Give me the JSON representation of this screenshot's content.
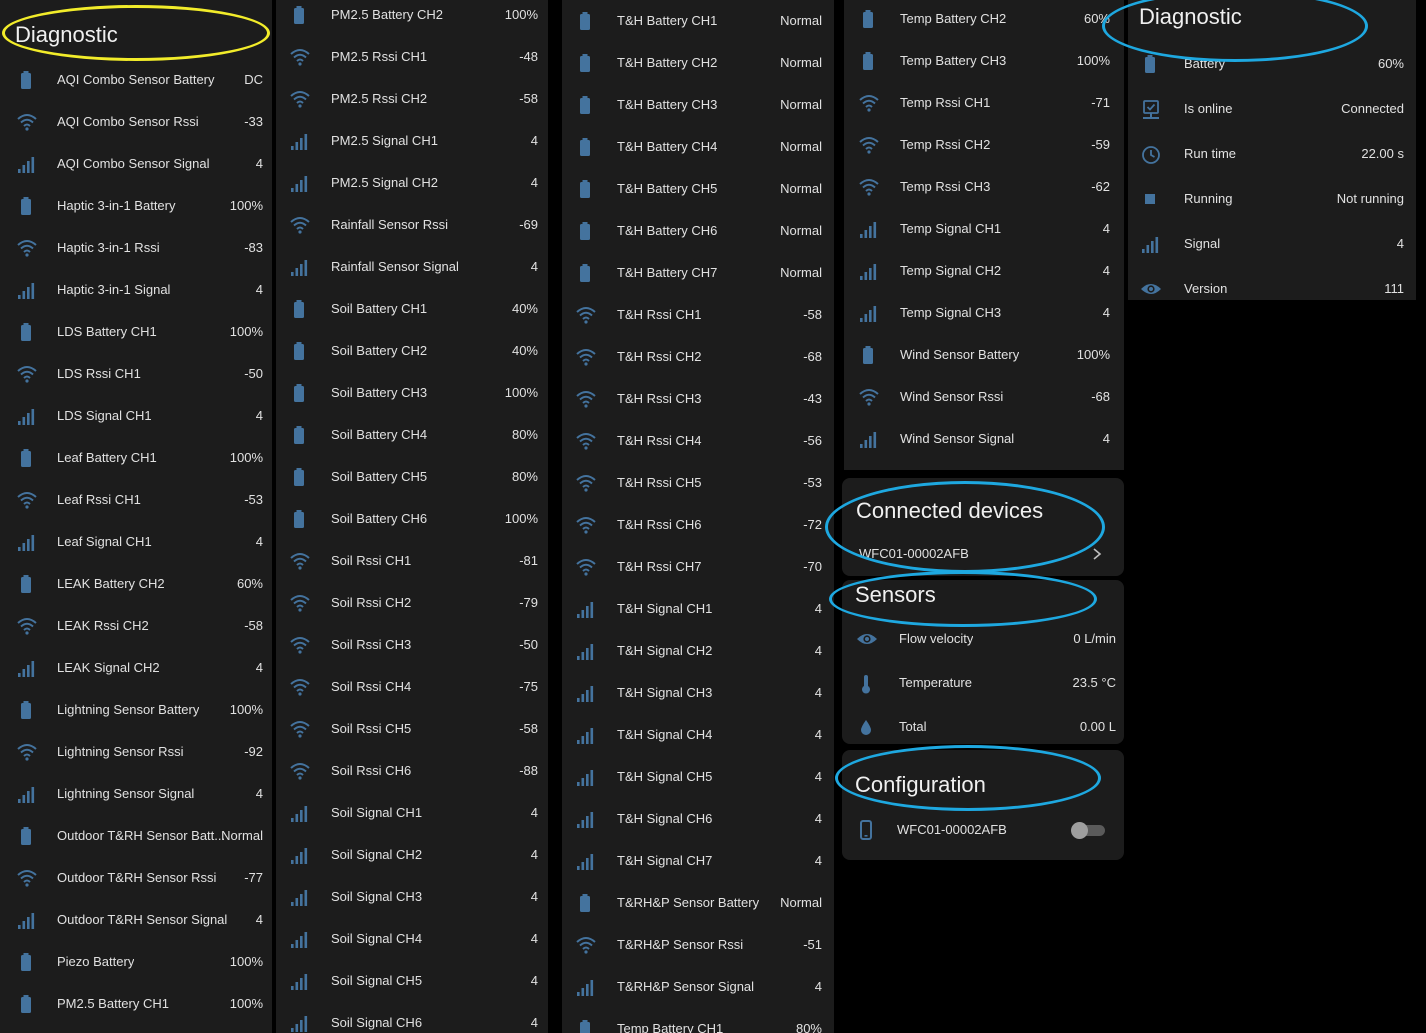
{
  "colors": {
    "accent": "#44739e",
    "background": "#1c1c1c",
    "yellow_annotation": "#f2ec2a",
    "blue_annotation": "#1ea8e0",
    "toggle_off": "#9e9e9e"
  },
  "diagnostic_title": "Diagnostic",
  "col1": [
    {
      "icon": "battery-icon",
      "name": "AQI Combo Sensor Battery",
      "value": "DC"
    },
    {
      "icon": "wifi-icon",
      "name": "AQI Combo Sensor Rssi",
      "value": "-33"
    },
    {
      "icon": "signal-icon",
      "name": "AQI Combo Sensor Signal",
      "value": "4"
    },
    {
      "icon": "battery-icon",
      "name": "Haptic 3-in-1 Battery",
      "value": "100%"
    },
    {
      "icon": "wifi-icon",
      "name": "Haptic 3-in-1 Rssi",
      "value": "-83"
    },
    {
      "icon": "signal-icon",
      "name": "Haptic 3-in-1 Signal",
      "value": "4"
    },
    {
      "icon": "battery-icon",
      "name": "LDS Battery CH1",
      "value": "100%"
    },
    {
      "icon": "wifi-icon",
      "name": "LDS Rssi CH1",
      "value": "-50"
    },
    {
      "icon": "signal-icon",
      "name": "LDS Signal CH1",
      "value": "4"
    },
    {
      "icon": "battery-icon",
      "name": "Leaf Battery CH1",
      "value": "100%"
    },
    {
      "icon": "wifi-icon",
      "name": "Leaf Rssi CH1",
      "value": "-53"
    },
    {
      "icon": "signal-icon",
      "name": "Leaf Signal CH1",
      "value": "4"
    },
    {
      "icon": "battery-icon",
      "name": "LEAK Battery CH2",
      "value": "60%"
    },
    {
      "icon": "wifi-icon",
      "name": "LEAK Rssi CH2",
      "value": "-58"
    },
    {
      "icon": "signal-icon",
      "name": "LEAK Signal CH2",
      "value": "4"
    },
    {
      "icon": "battery-icon",
      "name": "Lightning Sensor Battery",
      "value": "100%"
    },
    {
      "icon": "wifi-icon",
      "name": "Lightning Sensor Rssi",
      "value": "-92"
    },
    {
      "icon": "signal-icon",
      "name": "Lightning Sensor Signal",
      "value": "4"
    },
    {
      "icon": "battery-icon",
      "name": "Outdoor T&RH Sensor Batt...",
      "value": "Normal"
    },
    {
      "icon": "wifi-icon",
      "name": "Outdoor T&RH Sensor Rssi",
      "value": "-77"
    },
    {
      "icon": "signal-icon",
      "name": "Outdoor T&RH Sensor Signal",
      "value": "4"
    },
    {
      "icon": "battery-icon",
      "name": "Piezo Battery",
      "value": "100%"
    },
    {
      "icon": "battery-icon",
      "name": "PM2.5 Battery CH1",
      "value": "100%"
    }
  ],
  "col2": [
    {
      "icon": "battery-icon",
      "name": "PM2.5 Battery CH2",
      "value": "100%"
    },
    {
      "icon": "wifi-icon",
      "name": "PM2.5 Rssi CH1",
      "value": "-48"
    },
    {
      "icon": "wifi-icon",
      "name": "PM2.5 Rssi CH2",
      "value": "-58"
    },
    {
      "icon": "signal-icon",
      "name": "PM2.5 Signal CH1",
      "value": "4"
    },
    {
      "icon": "signal-icon",
      "name": "PM2.5 Signal CH2",
      "value": "4"
    },
    {
      "icon": "wifi-icon",
      "name": "Rainfall Sensor Rssi",
      "value": "-69"
    },
    {
      "icon": "signal-icon",
      "name": "Rainfall Sensor Signal",
      "value": "4"
    },
    {
      "icon": "battery-icon",
      "name": "Soil Battery CH1",
      "value": "40%"
    },
    {
      "icon": "battery-icon",
      "name": "Soil Battery CH2",
      "value": "40%"
    },
    {
      "icon": "battery-icon",
      "name": "Soil Battery CH3",
      "value": "100%"
    },
    {
      "icon": "battery-icon",
      "name": "Soil Battery CH4",
      "value": "80%"
    },
    {
      "icon": "battery-icon",
      "name": "Soil Battery CH5",
      "value": "80%"
    },
    {
      "icon": "battery-icon",
      "name": "Soil Battery CH6",
      "value": "100%"
    },
    {
      "icon": "wifi-icon",
      "name": "Soil Rssi CH1",
      "value": "-81"
    },
    {
      "icon": "wifi-icon",
      "name": "Soil Rssi CH2",
      "value": "-79"
    },
    {
      "icon": "wifi-icon",
      "name": "Soil Rssi CH3",
      "value": "-50"
    },
    {
      "icon": "wifi-icon",
      "name": "Soil Rssi CH4",
      "value": "-75"
    },
    {
      "icon": "wifi-icon",
      "name": "Soil Rssi CH5",
      "value": "-58"
    },
    {
      "icon": "wifi-icon",
      "name": "Soil Rssi CH6",
      "value": "-88"
    },
    {
      "icon": "signal-icon",
      "name": "Soil Signal CH1",
      "value": "4"
    },
    {
      "icon": "signal-icon",
      "name": "Soil Signal CH2",
      "value": "4"
    },
    {
      "icon": "signal-icon",
      "name": "Soil Signal CH3",
      "value": "4"
    },
    {
      "icon": "signal-icon",
      "name": "Soil Signal CH4",
      "value": "4"
    },
    {
      "icon": "signal-icon",
      "name": "Soil Signal CH5",
      "value": "4"
    },
    {
      "icon": "signal-icon",
      "name": "Soil Signal CH6",
      "value": "4"
    }
  ],
  "col3": [
    {
      "icon": "battery-icon",
      "name": "T&H Battery CH1",
      "value": "Normal"
    },
    {
      "icon": "battery-icon",
      "name": "T&H Battery CH2",
      "value": "Normal"
    },
    {
      "icon": "battery-icon",
      "name": "T&H Battery CH3",
      "value": "Normal"
    },
    {
      "icon": "battery-icon",
      "name": "T&H Battery CH4",
      "value": "Normal"
    },
    {
      "icon": "battery-icon",
      "name": "T&H Battery CH5",
      "value": "Normal"
    },
    {
      "icon": "battery-icon",
      "name": "T&H Battery CH6",
      "value": "Normal"
    },
    {
      "icon": "battery-icon",
      "name": "T&H Battery CH7",
      "value": "Normal"
    },
    {
      "icon": "wifi-icon",
      "name": "T&H Rssi CH1",
      "value": "-58"
    },
    {
      "icon": "wifi-icon",
      "name": "T&H Rssi CH2",
      "value": "-68"
    },
    {
      "icon": "wifi-icon",
      "name": "T&H Rssi CH3",
      "value": "-43"
    },
    {
      "icon": "wifi-icon",
      "name": "T&H Rssi CH4",
      "value": "-56"
    },
    {
      "icon": "wifi-icon",
      "name": "T&H Rssi CH5",
      "value": "-53"
    },
    {
      "icon": "wifi-icon",
      "name": "T&H Rssi CH6",
      "value": "-72"
    },
    {
      "icon": "wifi-icon",
      "name": "T&H Rssi CH7",
      "value": "-70"
    },
    {
      "icon": "signal-icon",
      "name": "T&H Signal CH1",
      "value": "4"
    },
    {
      "icon": "signal-icon",
      "name": "T&H Signal CH2",
      "value": "4"
    },
    {
      "icon": "signal-icon",
      "name": "T&H Signal CH3",
      "value": "4"
    },
    {
      "icon": "signal-icon",
      "name": "T&H Signal CH4",
      "value": "4"
    },
    {
      "icon": "signal-icon",
      "name": "T&H Signal CH5",
      "value": "4"
    },
    {
      "icon": "signal-icon",
      "name": "T&H Signal CH6",
      "value": "4"
    },
    {
      "icon": "signal-icon",
      "name": "T&H Signal CH7",
      "value": "4"
    },
    {
      "icon": "battery-icon",
      "name": "T&RH&P Sensor Battery",
      "value": "Normal"
    },
    {
      "icon": "wifi-icon",
      "name": "T&RH&P Sensor Rssi",
      "value": "-51"
    },
    {
      "icon": "signal-icon",
      "name": "T&RH&P Sensor Signal",
      "value": "4"
    },
    {
      "icon": "battery-icon",
      "name": "Temp Battery CH1",
      "value": "80%"
    }
  ],
  "col4": [
    {
      "icon": "battery-icon",
      "name": "Temp Battery CH2",
      "value": "60%"
    },
    {
      "icon": "battery-icon",
      "name": "Temp Battery CH3",
      "value": "100%"
    },
    {
      "icon": "wifi-icon",
      "name": "Temp Rssi CH1",
      "value": "-71"
    },
    {
      "icon": "wifi-icon",
      "name": "Temp Rssi CH2",
      "value": "-59"
    },
    {
      "icon": "wifi-icon",
      "name": "Temp Rssi CH3",
      "value": "-62"
    },
    {
      "icon": "signal-icon",
      "name": "Temp Signal CH1",
      "value": "4"
    },
    {
      "icon": "signal-icon",
      "name": "Temp Signal CH2",
      "value": "4"
    },
    {
      "icon": "signal-icon",
      "name": "Temp Signal CH3",
      "value": "4"
    },
    {
      "icon": "battery-icon",
      "name": "Wind Sensor Battery",
      "value": "100%"
    },
    {
      "icon": "wifi-icon",
      "name": "Wind Sensor Rssi",
      "value": "-68"
    },
    {
      "icon": "signal-icon",
      "name": "Wind Sensor Signal",
      "value": "4"
    }
  ],
  "connected": {
    "title": "Connected devices",
    "device": "WFC01-00002AFB"
  },
  "sensors": {
    "title": "Sensors",
    "items": [
      {
        "icon": "eye-icon",
        "name": "Flow velocity",
        "value": "0 L/min"
      },
      {
        "icon": "thermometer-icon",
        "name": "Temperature",
        "value": "23.5 °C"
      },
      {
        "icon": "water-drop-icon",
        "name": "Total",
        "value": "0.00 L"
      }
    ]
  },
  "configuration": {
    "title": "Configuration",
    "item": "WFC01-00002AFB",
    "toggle_on": false
  },
  "diag_right": [
    {
      "icon": "battery-icon",
      "name": "Battery",
      "value": "60%"
    },
    {
      "icon": "online-check-icon",
      "name": "Is online",
      "value": "Connected"
    },
    {
      "icon": "clock-icon",
      "name": "Run time",
      "value": "22.00 s"
    },
    {
      "icon": "stop-icon",
      "name": "Running",
      "value": "Not running"
    },
    {
      "icon": "signal-icon",
      "name": "Signal",
      "value": "4"
    },
    {
      "icon": "eye-icon",
      "name": "Version",
      "value": "111"
    }
  ]
}
